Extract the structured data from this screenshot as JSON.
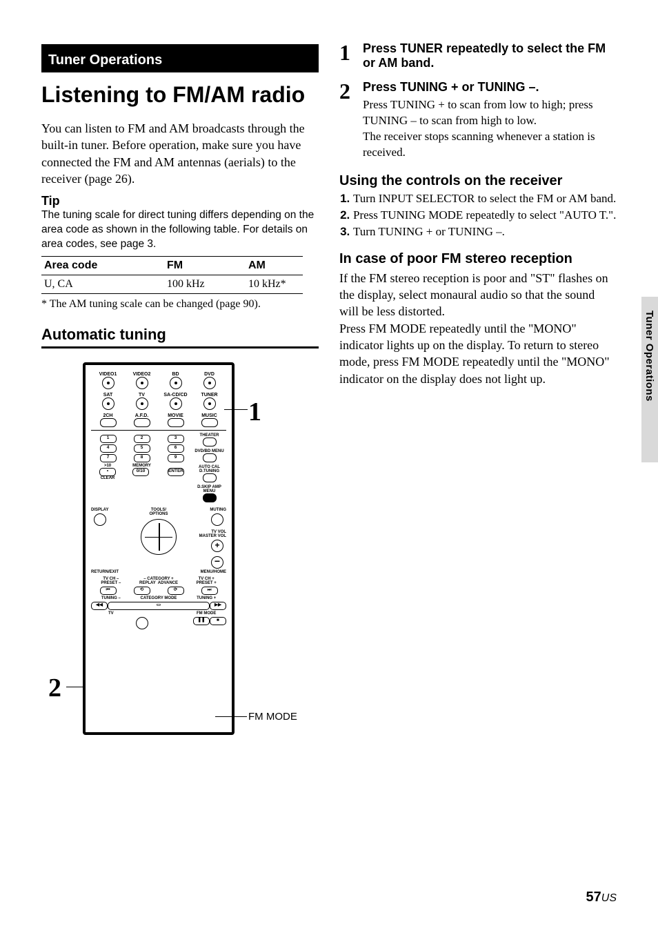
{
  "section_header": "Tuner Operations",
  "page_title": "Listening to FM/AM radio",
  "intro_text": "You can listen to FM and AM broadcasts through the built-in tuner. Before operation, make sure you have connected the FM and AM antennas (aerials) to the receiver (page 26).",
  "tip_label": "Tip",
  "tip_text": "The tuning scale for direct tuning differs depending on the area code as shown in the following table. For details on area codes, see page 3.",
  "area_table": {
    "headers": [
      "Area code",
      "FM",
      "AM"
    ],
    "rows": [
      {
        "code": "U, CA",
        "fm": "100 kHz",
        "am": "10 kHz*"
      }
    ]
  },
  "table_footnote": "* The AM tuning scale can be changed (page 90).",
  "subheading_auto": "Automatic tuning",
  "remote": {
    "row1": [
      "VIDEO1",
      "VIDEO2",
      "BD",
      "DVD"
    ],
    "row2": [
      "SAT",
      "TV",
      "SA-CD/CD",
      "TUNER"
    ],
    "row3": [
      "2CH",
      "A.F.D.",
      "MOVIE",
      "MUSIC"
    ],
    "side_labels": [
      "THEATER",
      "DVD/BD MENU",
      "AUTO CAL D.TUNING",
      "D.SKIP AMP MENU"
    ],
    "nums": [
      [
        "1",
        "2",
        "3"
      ],
      [
        "4",
        "5",
        "6"
      ],
      [
        "7",
        "8",
        "9"
      ]
    ],
    "bottom_nums": [
      ">10",
      "0/10",
      "ENTER"
    ],
    "bottom_labels": {
      "over10_sub": "CLEAR",
      "zero_pre": "MEMORY"
    },
    "display": "DISPLAY",
    "tools": "TOOLS/\nOPTIONS",
    "muting": "MUTING",
    "tv_vol": "TV VOL\nMASTER VOL",
    "return": "RETURN/EXIT",
    "menu": "MENU/HOME",
    "ch_row_labels": [
      "TV CH –\nPRESET –",
      "– CATEGORY +\nREPLAY  ADVANCE",
      "TV CH +\nPRESET +"
    ],
    "tune_row": [
      "TUNING –",
      "CATEGORY MODE",
      "TUNING +"
    ],
    "last_row": [
      "TV",
      "",
      "FM MODE"
    ]
  },
  "callouts": {
    "one": "1",
    "two": "2",
    "fm_mode": "FM MODE"
  },
  "steps": [
    {
      "num": "1",
      "head": "Press TUNER repeatedly to select the FM or AM band.",
      "body": ""
    },
    {
      "num": "2",
      "head": "Press TUNING + or TUNING –.",
      "body": "Press TUNING + to scan from low to high; press TUNING – to scan from high to low.\nThe receiver stops scanning whenever a station is received."
    }
  ],
  "controls_heading": "Using the controls on the receiver",
  "controls_steps": [
    "Turn INPUT SELECTOR to select the FM or AM band.",
    "Press TUNING MODE repeatedly to select \"AUTO T.\".",
    "Turn TUNING + or TUNING –."
  ],
  "poor_heading": "In case of poor FM stereo reception",
  "poor_body": "If the FM stereo reception is poor and \"ST\" flashes on the display, select monaural audio so that the sound will be less distorted.\nPress FM MODE repeatedly until the \"MONO\" indicator lights up on the display. To return to stereo mode, press FM MODE repeatedly until the \"MONO\" indicator on the display does not light up.",
  "side_tab_label": "Tuner Operations",
  "page_number": "57",
  "page_number_suffix": "US"
}
